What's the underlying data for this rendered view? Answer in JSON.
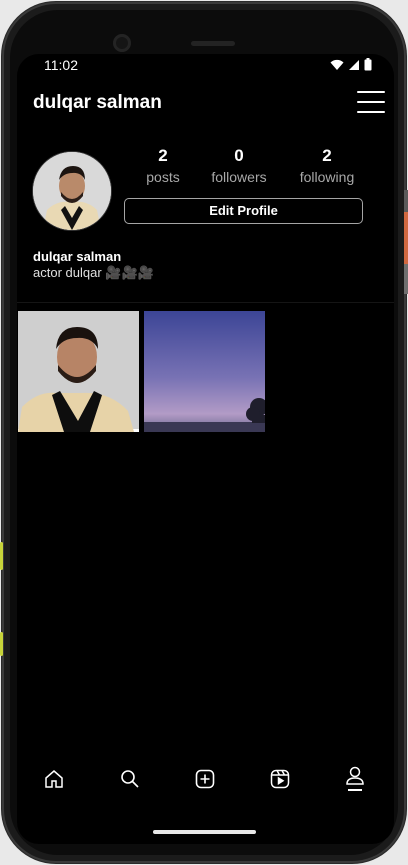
{
  "status_bar": {
    "time": "11:02"
  },
  "profile": {
    "username": "dulqar salman",
    "display_name": "dulqar salman",
    "bio": "actor dulqar 🎥🎥🎥",
    "stats": [
      {
        "value": "2",
        "label": "posts"
      },
      {
        "value": "0",
        "label": "followers"
      },
      {
        "value": "2",
        "label": "following"
      }
    ],
    "edit_button": "Edit Profile"
  },
  "posts": [
    {
      "kind": "portrait-photo"
    },
    {
      "kind": "sky-photo"
    }
  ],
  "bottom_nav": [
    {
      "icon": "home-icon"
    },
    {
      "icon": "search-icon"
    },
    {
      "icon": "add-post-icon"
    },
    {
      "icon": "reels-icon"
    },
    {
      "icon": "profile-icon"
    }
  ],
  "colors": {
    "background": "#000000",
    "text": "#ffffff",
    "muted": "#a8a8a8",
    "button_border": "#a5a5a5"
  }
}
